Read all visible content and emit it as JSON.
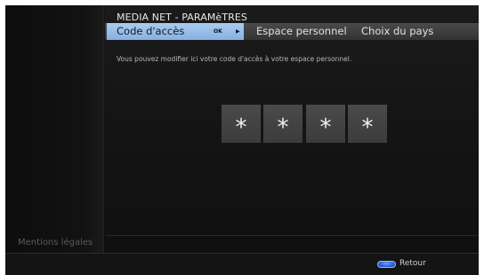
{
  "header": {
    "title": "MEDIA NET - PARAMèTRES"
  },
  "tabs": [
    {
      "label": "Code d'accès",
      "active": true,
      "ok_label": "OK"
    },
    {
      "label": "Espace personnel",
      "active": false
    },
    {
      "label": "Choix du pays",
      "active": false
    }
  ],
  "main": {
    "description": "Vous pouvez modifier ici votre code d'accès à votre espace personnel.",
    "code_digits": [
      "*",
      "*",
      "*",
      "*"
    ]
  },
  "sidebar": {
    "legal_link": "Mentions légales"
  },
  "footer": {
    "back_label": "Retour",
    "back_key_color": "#2c5fd6"
  },
  "colors": {
    "active_tab": "#a9cbf0",
    "background": "#121212"
  }
}
